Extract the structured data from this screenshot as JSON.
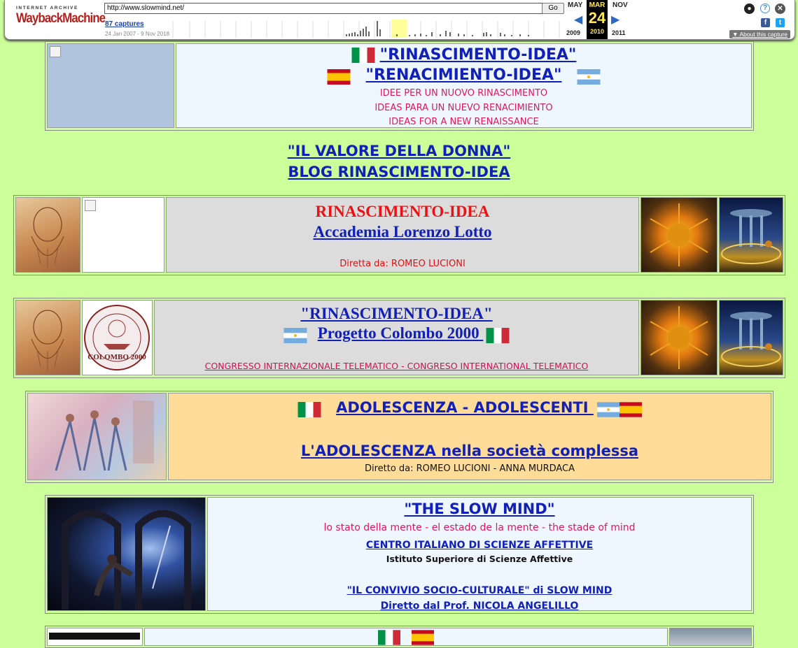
{
  "wayback": {
    "archive_label": "INTERNET ARCHIVE",
    "logo_label": "WaybackMachine",
    "url": "http://www.slowmind.net/",
    "go_label": "Go",
    "captures": "87 captures",
    "range": "24 Jan 2007 - 9 Nov 2018",
    "prev_month": "MAY",
    "cur_month": "MAR",
    "next_month": "NOV",
    "cur_day": "24",
    "prev_year": "2009",
    "cur_year": "2010",
    "next_year": "2011",
    "about": "About this capture",
    "icons": [
      "user-icon",
      "help-icon",
      "close-icon",
      "facebook-icon",
      "twitter-icon"
    ]
  },
  "banner1": {
    "title_it": "\"RINASCIMENTO-IDEA\"",
    "title_es": "\"RENACIMIENTO-IDEA\"",
    "line1": "IDEE PER UN NUOVO RINASCIMENTO",
    "line2": "IDEAS PARA UN NUEVO RENACIMIENTO",
    "line3": "IDEAS FOR A NEW RENAISSANCE"
  },
  "center_links": {
    "link1": "\"IL VALORE DELLA DONNA\"",
    "link2": "BLOG RINASCIMENTO-IDEA"
  },
  "row_accademia": {
    "title": "RINASCIMENTO-IDEA",
    "link": "Accademia Lorenzo Lotto",
    "director": "Diretta da: ROMEO LUCIONI"
  },
  "row_colombo": {
    "title": "\"RINASCIMENTO-IDEA\"",
    "link": "Progetto Colombo 2000 ",
    "congress": "CONGRESSO INTERNAZIONALE TELEMATICO - CONGRESO INTERNATIONAL TELEMATICO",
    "seal_text": "COLOMBO 2000"
  },
  "row_adolescenza": {
    "title": "ADOLESCENZA - ADOLESCENTI ",
    "link": "L'ADOLESCENZA nella società complessa",
    "director": "Diretto da: ROMEO LUCIONI - ANNA MURDACA"
  },
  "row_slowmind": {
    "title": "\"THE SLOW MIND\"",
    "subtitle": "lo stato della mente - el estado de la mente - the stade of mind",
    "centro": "CENTRO ITALIANO DI SCIENZE AFFETTIVE",
    "istituto": "Istituto Superiore di Scienze Affettive",
    "convivio": "\"IL CONVIVIO SOCIO-CULTURALE\" di SLOW MIND",
    "diretto": "Diretto dal Prof. NICOLA ANGELILLO"
  },
  "colors": {
    "page_bg": "#ccff99",
    "light_blue": "#eef6ff",
    "gray": "#dcdcdc",
    "peach": "#ffdd99",
    "link": "#1020b8",
    "pink": "#e0185a"
  }
}
